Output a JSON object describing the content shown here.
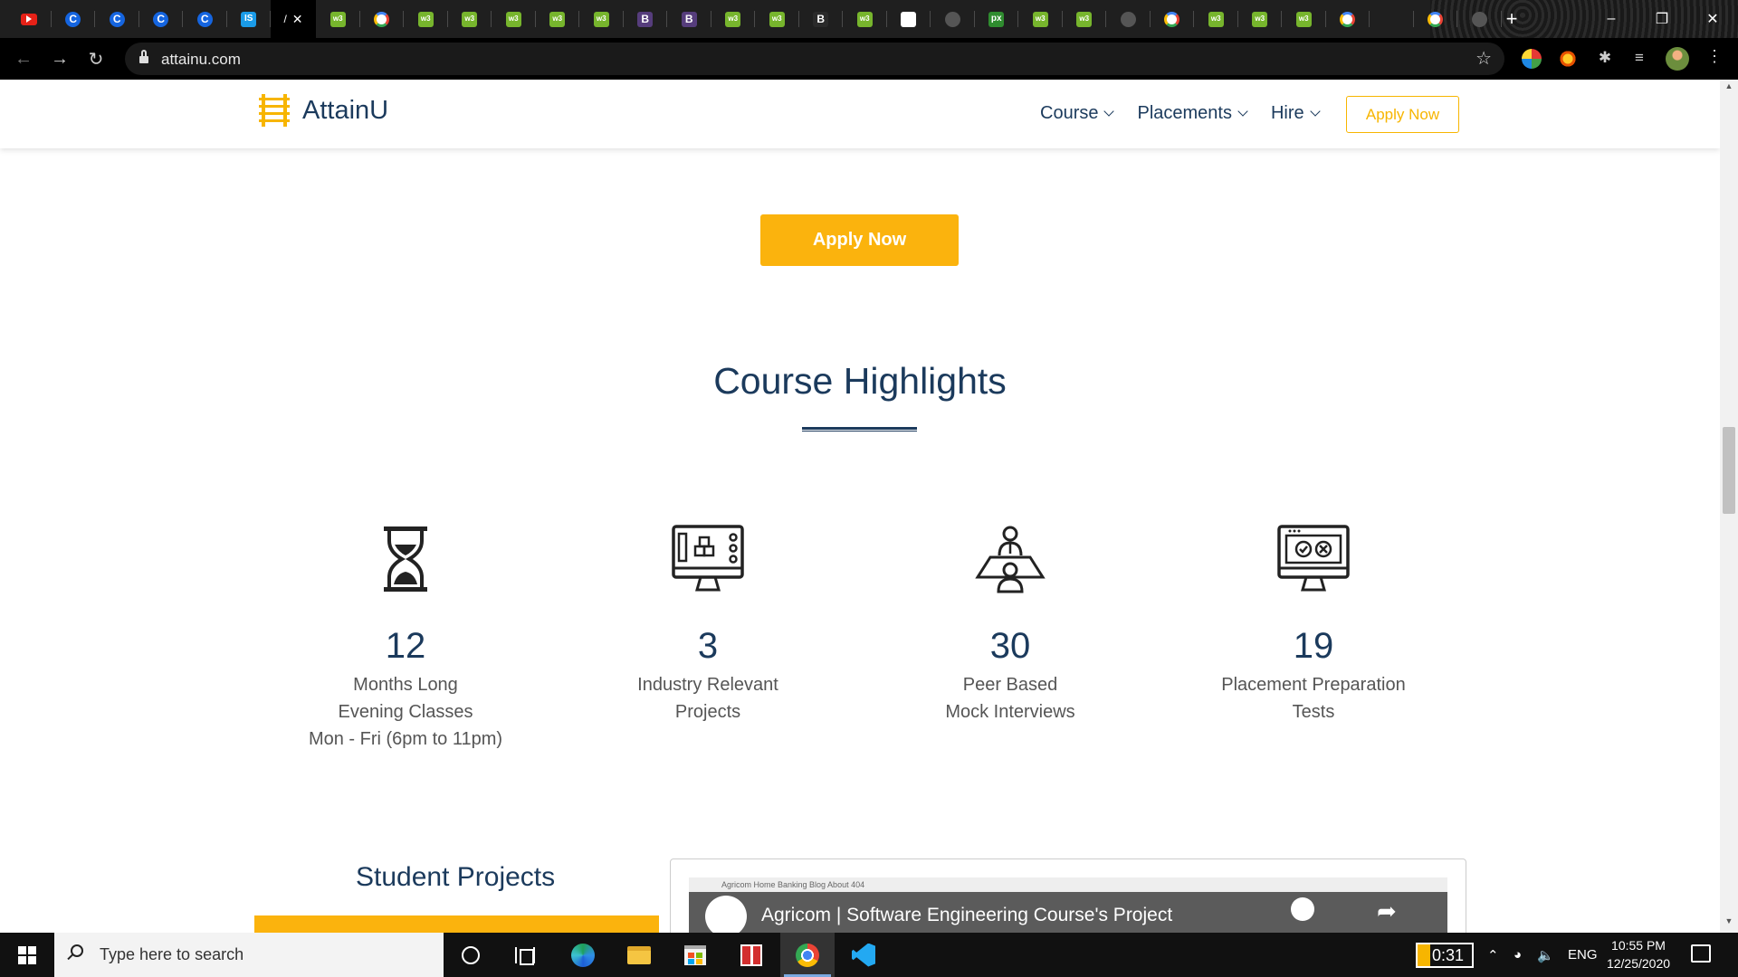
{
  "browser": {
    "tabs": [
      {
        "icon": "youtube-icon",
        "kind": "yt",
        "glyph": ""
      },
      {
        "icon": "c-icon",
        "kind": "c",
        "glyph": "C"
      },
      {
        "icon": "c-icon",
        "kind": "c",
        "glyph": "C"
      },
      {
        "icon": "c-icon",
        "kind": "c",
        "glyph": "C"
      },
      {
        "icon": "c-icon",
        "kind": "c",
        "glyph": "C"
      },
      {
        "icon": "is-icon",
        "kind": "is",
        "glyph": "IS"
      },
      {
        "icon": "attainu-icon",
        "kind": "active",
        "glyph": "/"
      },
      {
        "icon": "w3schools-icon",
        "kind": "w3",
        "glyph": "w3"
      },
      {
        "icon": "google-icon",
        "kind": "g",
        "glyph": ""
      },
      {
        "icon": "w3schools-icon",
        "kind": "w3",
        "glyph": "w3"
      },
      {
        "icon": "w3schools-icon",
        "kind": "w3",
        "glyph": "w3"
      },
      {
        "icon": "w3schools-icon",
        "kind": "w3",
        "glyph": "w3"
      },
      {
        "icon": "w3schools-icon",
        "kind": "w3",
        "glyph": "w3"
      },
      {
        "icon": "w3schools-icon",
        "kind": "w3",
        "glyph": "w3"
      },
      {
        "icon": "bootstrap-icon",
        "kind": "b",
        "glyph": "B"
      },
      {
        "icon": "bootstrap-icon",
        "kind": "b",
        "glyph": "B"
      },
      {
        "icon": "w3schools-icon",
        "kind": "w3",
        "glyph": "w3"
      },
      {
        "icon": "w3schools-icon",
        "kind": "w3",
        "glyph": "w3"
      },
      {
        "icon": "bootstrap-icon",
        "kind": "b dark",
        "glyph": "B"
      },
      {
        "icon": "w3schools-icon",
        "kind": "w3",
        "glyph": "w3"
      },
      {
        "icon": "flag-icon",
        "kind": "flag",
        "glyph": ""
      },
      {
        "icon": "globe-icon",
        "kind": "grey",
        "glyph": ""
      },
      {
        "icon": "px-icon",
        "kind": "px",
        "glyph": "px"
      },
      {
        "icon": "w3schools-icon",
        "kind": "w3",
        "glyph": "w3"
      },
      {
        "icon": "w3schools-icon",
        "kind": "w3",
        "glyph": "w3"
      },
      {
        "icon": "globe-icon",
        "kind": "grey",
        "glyph": ""
      },
      {
        "icon": "google-icon",
        "kind": "g",
        "glyph": ""
      },
      {
        "icon": "w3schools-icon",
        "kind": "w3",
        "glyph": "w3"
      },
      {
        "icon": "w3schools-icon",
        "kind": "w3",
        "glyph": "w3"
      },
      {
        "icon": "w3schools-icon",
        "kind": "w3",
        "glyph": "w3"
      },
      {
        "icon": "google-icon",
        "kind": "g",
        "glyph": ""
      },
      {
        "icon": "apple-icon",
        "kind": "apple",
        "glyph": ""
      },
      {
        "icon": "google-icon",
        "kind": "g",
        "glyph": ""
      },
      {
        "icon": "globe-icon",
        "kind": "grey",
        "glyph": ""
      }
    ],
    "url": "attainu.com"
  },
  "site": {
    "brand": "AttainU",
    "nav": [
      "Course",
      "Placements",
      "Hire"
    ],
    "header_cta": "Apply Now",
    "main_cta": "Apply Now",
    "highlights_title": "Course Highlights",
    "stats": [
      {
        "icon": "hourglass-icon",
        "value": "12",
        "lines": [
          "Months Long",
          "Evening Classes",
          "Mon - Fri (6pm to 11pm)"
        ]
      },
      {
        "icon": "monitor-projects-icon",
        "value": "3",
        "lines": [
          "Industry Relevant",
          "Projects"
        ]
      },
      {
        "icon": "interview-icon",
        "value": "30",
        "lines": [
          "Peer Based",
          "Mock Interviews"
        ]
      },
      {
        "icon": "test-monitor-icon",
        "value": "19",
        "lines": [
          "Placement Preparation",
          "Tests"
        ]
      }
    ],
    "student_projects_title": "Student Projects",
    "video": {
      "nav_text": "Agricom   Home   Banking   Blog   About   404",
      "title": "Agricom | Software Engineering Course's Project"
    }
  },
  "taskbar": {
    "search_placeholder": "Type here to search",
    "battery_time": "0:31",
    "language": "ENG",
    "time": "10:55 PM",
    "date": "12/25/2020"
  },
  "colors": {
    "navy": "#1b3a5c",
    "accent": "#fbb30d"
  }
}
